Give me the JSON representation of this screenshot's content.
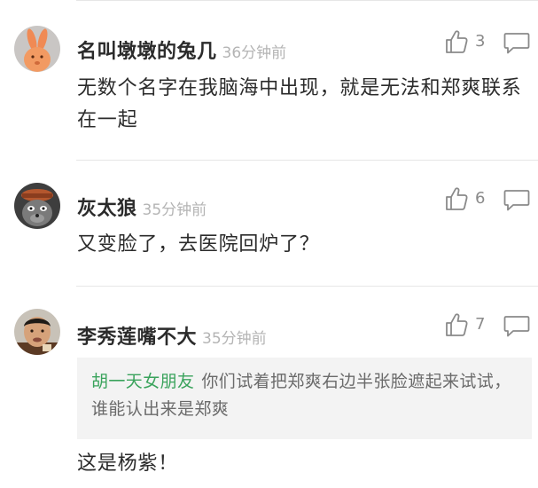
{
  "comments": [
    {
      "username": "名叫墩墩的兔几",
      "time": "36分钟前",
      "likes": "3",
      "content": "无数个名字在我脑海中出现，就是无法和郑爽联系在一起",
      "avatar": "rabbit-avatar"
    },
    {
      "username": "灰太狼",
      "time": "35分钟前",
      "likes": "6",
      "content": "又变脸了，去医院回炉了？",
      "avatar": "wolf-avatar"
    },
    {
      "username": "李秀莲嘴不大",
      "time": "35分钟前",
      "likes": "7",
      "quote": {
        "author": "胡一天女朋友",
        "text": "你们试着把郑爽右边半张脸遮起来试试，谁能认出来是郑爽"
      },
      "content": "这是杨紫！",
      "avatar": "man-avatar"
    }
  ],
  "icons": {
    "like": "thumbs-up-icon",
    "reply": "comment-bubble-icon"
  },
  "colors": {
    "quote_author": "#3aa35c",
    "timestamp": "#b4b4b4",
    "quote_background": "#f3f3f3"
  }
}
